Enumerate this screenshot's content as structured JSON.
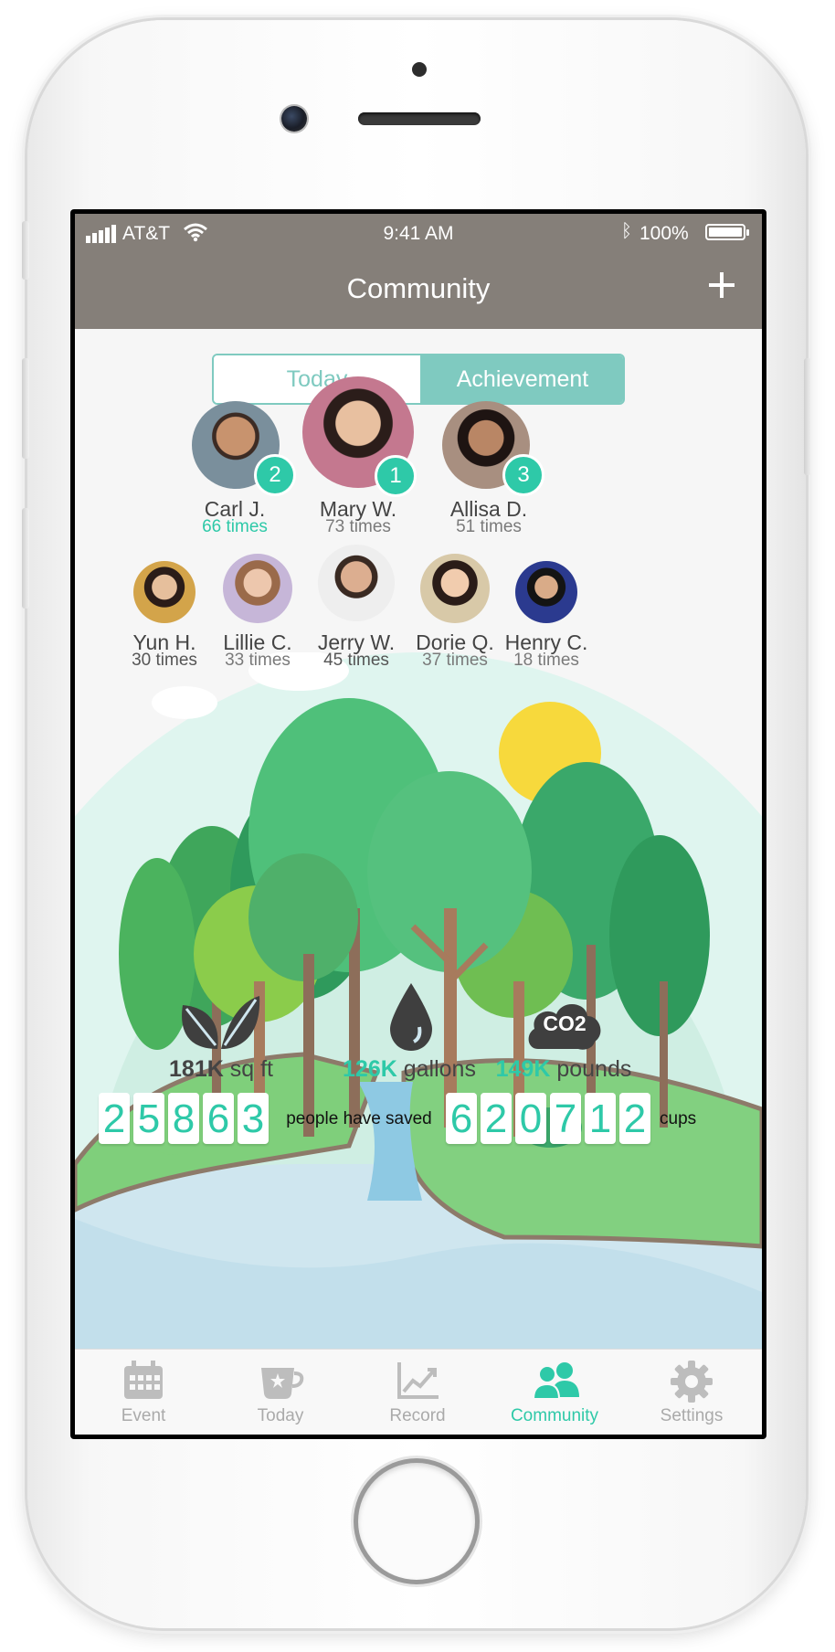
{
  "status": {
    "carrier": "AT&T",
    "time": "9:41 AM",
    "battery": "100%"
  },
  "nav": {
    "title": "Community"
  },
  "segment": {
    "today": "Today",
    "achievement": "Achievement"
  },
  "podium": [
    {
      "name": "Carl J.",
      "times": "66 times",
      "rank": "2"
    },
    {
      "name": "Mary W.",
      "times": "73 times",
      "rank": "1"
    },
    {
      "name": "Allisa D.",
      "times": "51 times",
      "rank": "3"
    }
  ],
  "others": [
    {
      "name": "Yun H.",
      "times": "30 times"
    },
    {
      "name": "Lillie C.",
      "times": "33 times"
    },
    {
      "name": "Jerry W.",
      "times": "45 times"
    },
    {
      "name": "Dorie Q.",
      "times": "37 times"
    },
    {
      "name": "Henry C.",
      "times": "18 times"
    }
  ],
  "stats": [
    {
      "value": "181K",
      "unit": "sq ft"
    },
    {
      "value": "126K",
      "unit": "gallons"
    },
    {
      "value": "149K",
      "unit": "pounds"
    }
  ],
  "co2_label": "CO2",
  "counter": {
    "people_digits": [
      "2",
      "5",
      "8",
      "6",
      "3"
    ],
    "people_label": "people have saved",
    "cups_digits": [
      "6",
      "2",
      "0",
      "7",
      "1",
      "2"
    ],
    "cups_label": "cups"
  },
  "tabs": [
    "Event",
    "Today",
    "Record",
    "Community",
    "Settings"
  ],
  "colors": {
    "accent": "#2ec9a8",
    "navbar": "#857f79",
    "segment": "#7fcac0"
  }
}
